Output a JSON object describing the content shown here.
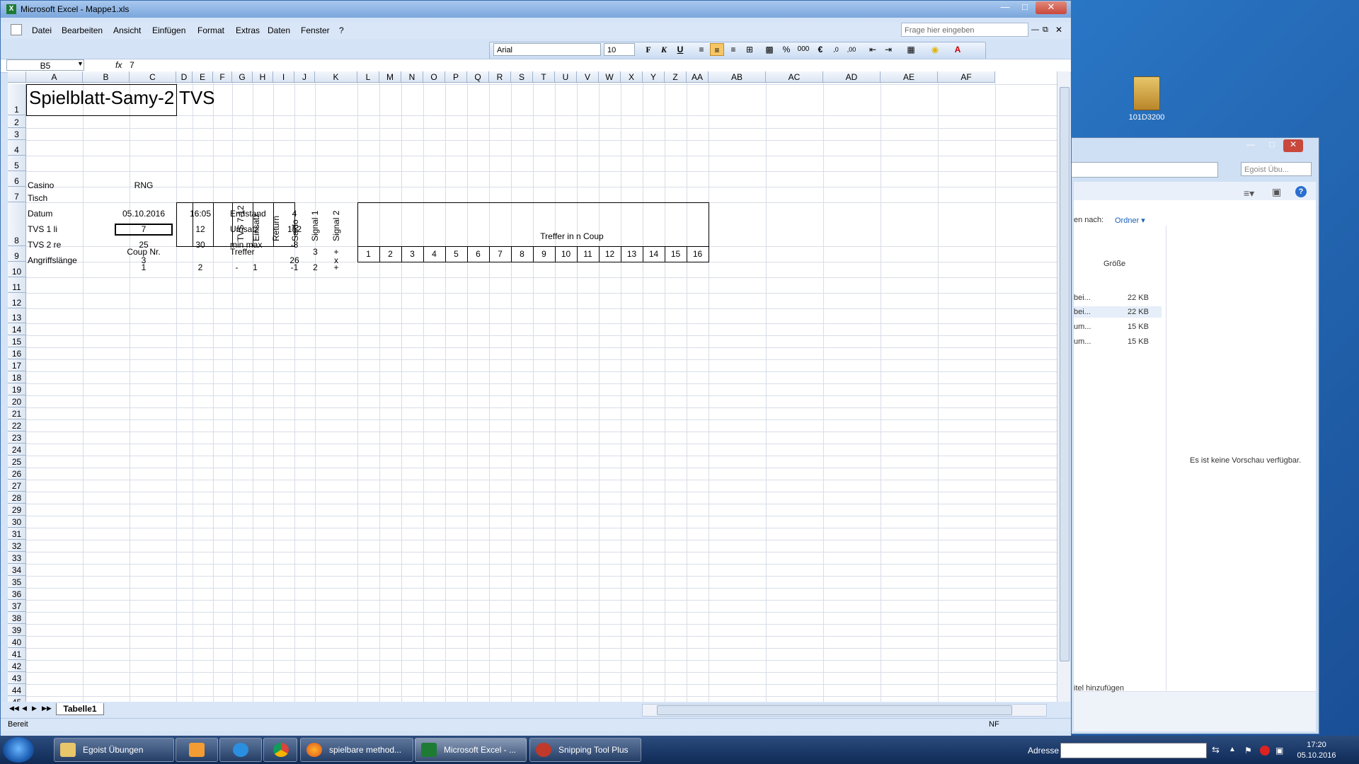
{
  "window": {
    "title": "Microsoft Excel - Mappe1.xls"
  },
  "menu": [
    "Datei",
    "Bearbeiten",
    "Ansicht",
    "Einfügen",
    "Format",
    "Extras",
    "Daten",
    "Fenster",
    "?"
  ],
  "help_placeholder": "Frage hier eingeben",
  "toolbar": {
    "font": "Arial",
    "size": "10",
    "bold": "F",
    "italic": "K",
    "underline": "U",
    "percent": "%",
    "thousands": "000",
    "euro": "€"
  },
  "formula": {
    "namebox": "B5",
    "fx": "fx",
    "value": "7"
  },
  "columns": [
    "A",
    "B",
    "C",
    "D",
    "E",
    "F",
    "G",
    "H",
    "I",
    "J",
    "K",
    "L",
    "M",
    "N",
    "O",
    "P",
    "Q",
    "R",
    "S",
    "T",
    "U",
    "V",
    "W",
    "X",
    "Y",
    "Z",
    "AA",
    "AB",
    "AC",
    "AD",
    "AE",
    "AF"
  ],
  "cells": {
    "title": "Spielblatt-Samy-2 TVS",
    "a2": "Casino",
    "b2": "RNG",
    "a3": "Tisch",
    "a4": "Datum",
    "b4": "05.10.2016",
    "c4": "16:05",
    "d4": "Endstand",
    "g4": "4",
    "a5": "TVS 1   li",
    "b5": "7",
    "c5": "12",
    "d5": "Umsatz",
    "g5": "152",
    "a6": "TVS 2   re",
    "b6": "25",
    "c6": "30",
    "d6": "min  max",
    "g6": "-8",
    "a7": "Angriffslänge",
    "b7": "3",
    "g7": "26",
    "i7": "x",
    "d8": "TVS 7-12",
    "e8": "Einsatz",
    "f8": "Return",
    "g8": "Saldo",
    "h8": "Signal 1",
    "i8": "Signal 2",
    "treffer_header": "Treffer in n Coup",
    "b9": "Coup Nr.",
    "d9": "Treffer",
    "h9": "3",
    "i9": "+",
    "b10": "1",
    "c10": "2",
    "d10": "-",
    "e10": "1",
    "g10": "-1",
    "h10": "2",
    "i10": "+",
    "coups": [
      "1",
      "2",
      "3",
      "4",
      "5",
      "6",
      "7",
      "8",
      "9",
      "10",
      "11",
      "12",
      "13",
      "14",
      "15",
      "16"
    ]
  },
  "sheet": {
    "tab": "Tabelle1"
  },
  "status": {
    "left": "Bereit",
    "right": "NF"
  },
  "explorer": {
    "search": "Egoist Übu...",
    "sort_label": "en nach:",
    "sort_value": "Ordner",
    "col_size": "Größe",
    "files": [
      {
        "name": "bei...",
        "size": "22 KB"
      },
      {
        "name": "bei...",
        "size": "22 KB"
      },
      {
        "name": "um...",
        "size": "15 KB"
      },
      {
        "name": "um...",
        "size": "15 KB"
      }
    ],
    "preview": "Es ist keine Vorschau verfügbar.",
    "footer": "itel hinzufügen"
  },
  "desktop_icon": "101D3200",
  "taskbar": {
    "items": [
      "Egoist Übungen",
      "",
      "",
      "",
      "spielbare method...",
      "Microsoft Excel - ...",
      "Snipping Tool Plus"
    ],
    "address_label": "Adresse",
    "time": "17:20",
    "date": "05.10.2016"
  }
}
